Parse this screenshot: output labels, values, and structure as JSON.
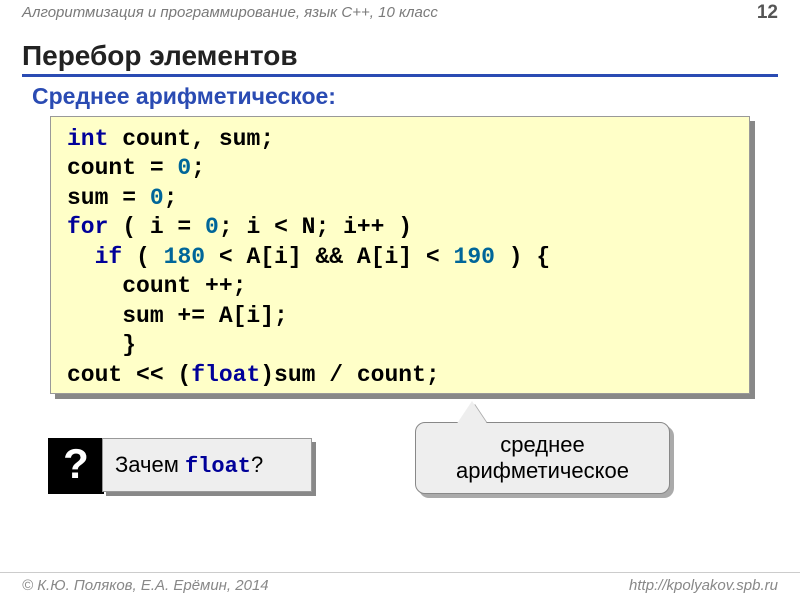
{
  "header": {
    "course": "Алгоритмизация и программирование, язык C++, 10 класс",
    "page": "12"
  },
  "title": "Перебор элементов",
  "subtitle": "Среднее арифметическое:",
  "code": {
    "l1a": "int",
    "l1b": " count, sum;",
    "l2a": "count = ",
    "l2b": "0",
    "l2c": ";",
    "l3a": "sum = ",
    "l3b": "0",
    "l3c": ";",
    "l4a": "for",
    "l4b": " ( i = ",
    "l4c": "0",
    "l4d": "; i < N; i++ )",
    "l5a": "  if",
    "l5b": " ( ",
    "l5c": "180",
    "l5d": " < A[i] && A[i] < ",
    "l5e": "190",
    "l5f": " ) {",
    "l6": "    count ++;",
    "l7": "    sum += A[i];",
    "l8": "    }",
    "l9a": "cout << (",
    "l9b": "float",
    "l9c": ")sum / count;"
  },
  "question": {
    "mark": "?",
    "before": "Зачем ",
    "word": "float",
    "after": "?"
  },
  "callout": {
    "line1": "среднее",
    "line2": "арифметическое"
  },
  "footer": {
    "left": "© К.Ю. Поляков, Е.А. Ерёмин, 2014",
    "right": "http://kpolyakov.spb.ru"
  }
}
